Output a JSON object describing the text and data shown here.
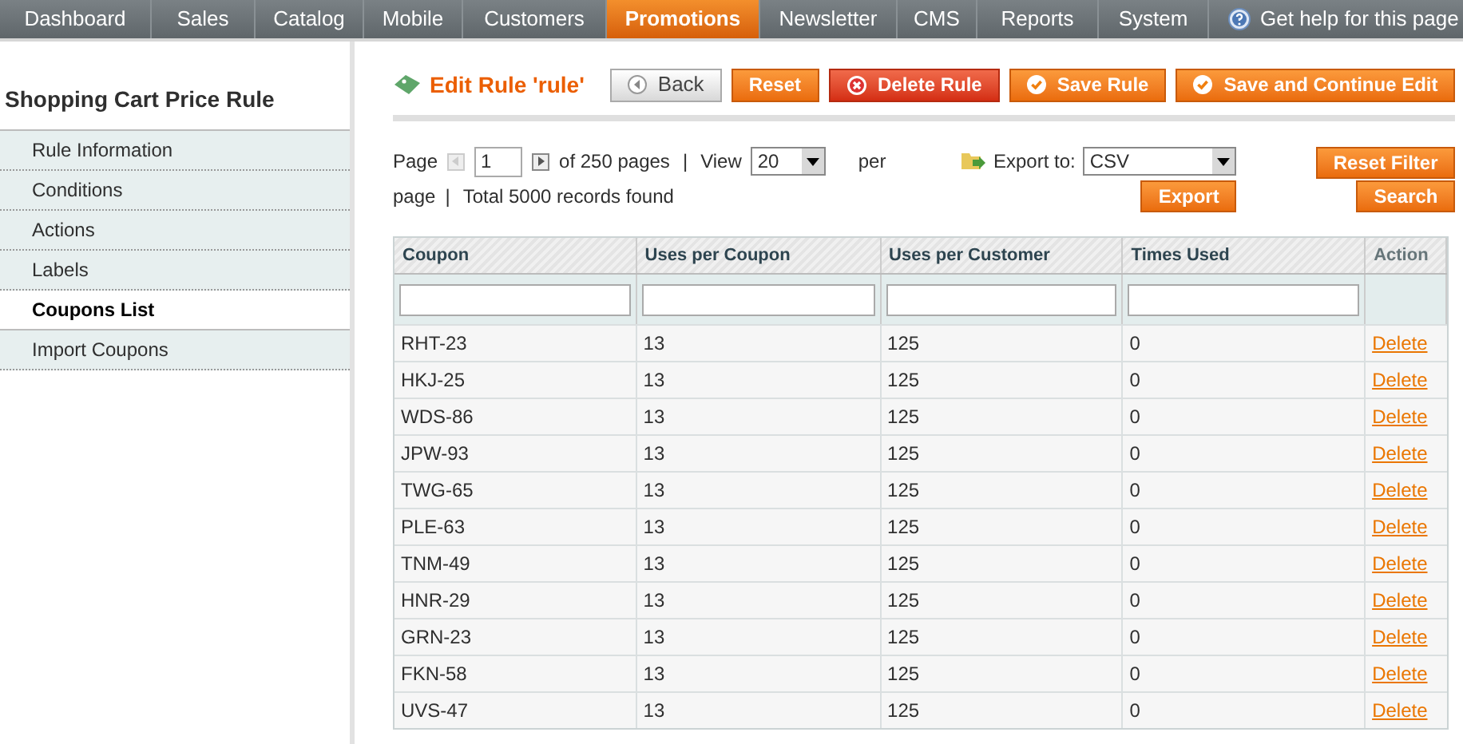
{
  "nav": {
    "items": [
      {
        "label": "Dashboard",
        "selected": false
      },
      {
        "label": "Sales",
        "selected": false
      },
      {
        "label": "Catalog",
        "selected": false
      },
      {
        "label": "Mobile",
        "selected": false
      },
      {
        "label": "Customers",
        "selected": false
      },
      {
        "label": "Promotions",
        "selected": true
      },
      {
        "label": "Newsletter",
        "selected": false
      },
      {
        "label": "CMS",
        "selected": false
      },
      {
        "label": "Reports",
        "selected": false
      },
      {
        "label": "System",
        "selected": false
      }
    ],
    "help": "Get help for this page"
  },
  "sidebar": {
    "title": "Shopping Cart Price Rule",
    "items": [
      {
        "label": "Rule Information",
        "selected": false
      },
      {
        "label": "Conditions",
        "selected": false
      },
      {
        "label": "Actions",
        "selected": false
      },
      {
        "label": "Labels",
        "selected": false
      },
      {
        "label": "Coupons List",
        "selected": true
      },
      {
        "label": "Import Coupons",
        "selected": false
      }
    ]
  },
  "page_title": "Edit Rule 'rule'",
  "buttons": [
    {
      "label": "Back",
      "kind": "back"
    },
    {
      "label": "Reset",
      "kind": "plain"
    },
    {
      "label": "Delete Rule",
      "kind": "delete"
    },
    {
      "label": "Save Rule",
      "kind": "save"
    },
    {
      "label": "Save and Continue Edit",
      "kind": "save"
    }
  ],
  "pager": {
    "page_label": "Page",
    "page": "1",
    "of_pages": "of 250 pages",
    "sep1": "|",
    "view_label": "View",
    "per_page": "20",
    "per_label": "per",
    "page_word": "page",
    "sep2": "|",
    "total": "Total 5000 records found"
  },
  "export": {
    "label": "Export to:",
    "format": "CSV",
    "button": "Export"
  },
  "filter_buttons": [
    "Reset Filter",
    "Search"
  ],
  "table": {
    "columns": [
      "Coupon",
      "Uses per Coupon",
      "Uses per Customer",
      "Times Used",
      "Action"
    ],
    "rows": [
      [
        "RHT-23",
        "13",
        "125",
        "0",
        "Delete"
      ],
      [
        "HKJ-25",
        "13",
        "125",
        "0",
        "Delete"
      ],
      [
        "WDS-86",
        "13",
        "125",
        "0",
        "Delete"
      ],
      [
        "JPW-93",
        "13",
        "125",
        "0",
        "Delete"
      ],
      [
        "TWG-65",
        "13",
        "125",
        "0",
        "Delete"
      ],
      [
        "PLE-63",
        "13",
        "125",
        "0",
        "Delete"
      ],
      [
        "TNM-49",
        "13",
        "125",
        "0",
        "Delete"
      ],
      [
        "HNR-29",
        "13",
        "125",
        "0",
        "Delete"
      ],
      [
        "GRN-23",
        "13",
        "125",
        "0",
        "Delete"
      ],
      [
        "FKN-58",
        "13",
        "125",
        "0",
        "Delete"
      ],
      [
        "UVS-47",
        "13",
        "125",
        "0",
        "Delete"
      ]
    ]
  }
}
